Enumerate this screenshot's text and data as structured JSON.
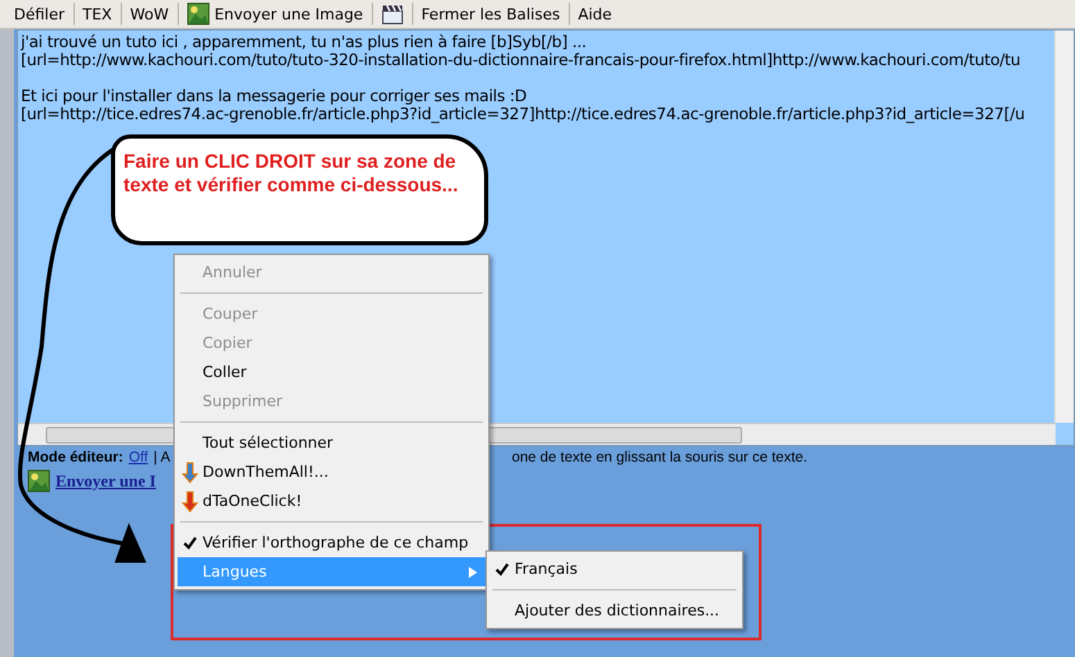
{
  "toolbar": [
    {
      "kind": "text",
      "label": "Défiler"
    },
    {
      "kind": "text",
      "label": "TEX"
    },
    {
      "kind": "text",
      "label": "WoW"
    },
    {
      "kind": "image",
      "label": "Envoyer une Image"
    },
    {
      "kind": "video"
    },
    {
      "kind": "text",
      "label": "Fermer les Balises"
    },
    {
      "kind": "text",
      "label": "Aide"
    }
  ],
  "editor": {
    "paragraphs": [
      [
        "j'ai trouvé un tuto ici , apparemment, tu n'as plus rien à faire [b]Syb[/b] ...",
        "[url=http://www.kachouri.com/tuto/tuto-320-installation-du-dictionnaire-francais-pour-firefox.html]http://www.kachouri.com/tuto/tu"
      ],
      [
        "Et ici pour l'installer dans la messagerie pour corriger ses mails :D",
        "[url=http://tice.edres74.ac-grenoble.fr/article.php3?id_article=327]http://tice.edres74.ac-grenoble.fr/article.php3?id_article=327[/u"
      ]
    ]
  },
  "status": {
    "label": "Mode éditeur:",
    "link": "Off",
    "before": "| A",
    "after": "one de texte en glissant la souris sur ce texte."
  },
  "upload_link": "Envoyer une I",
  "callout": {
    "text": "Faire un CLIC DROIT sur sa zone de texte et vérifier comme ci-dessous..."
  },
  "context_menu": [
    {
      "kind": "item",
      "label": "Annuler",
      "disabled": true
    },
    {
      "kind": "separator"
    },
    {
      "kind": "item",
      "label": "Couper",
      "disabled": true
    },
    {
      "kind": "item",
      "label": "Copier",
      "disabled": true
    },
    {
      "kind": "item",
      "label": "Coller",
      "disabled": false
    },
    {
      "kind": "item",
      "label": "Supprimer",
      "disabled": true
    },
    {
      "kind": "separator"
    },
    {
      "kind": "item",
      "label": "Tout sélectionner",
      "disabled": false
    },
    {
      "kind": "addon",
      "label": "DownThemAll!...",
      "color": "#3a7fc8"
    },
    {
      "kind": "addon",
      "label": "dTaOneClick!",
      "color": "#d8301a"
    },
    {
      "kind": "separator"
    },
    {
      "kind": "check",
      "label": "Vérifier l'orthographe de ce champ",
      "checked": true,
      "selected": false
    },
    {
      "kind": "submenu",
      "label": "Langues",
      "selected": true
    }
  ],
  "submenu": [
    {
      "kind": "check",
      "label": "Français",
      "checked": true
    },
    {
      "kind": "separator"
    },
    {
      "kind": "item",
      "label": "Ajouter des dictionnaires..."
    }
  ]
}
